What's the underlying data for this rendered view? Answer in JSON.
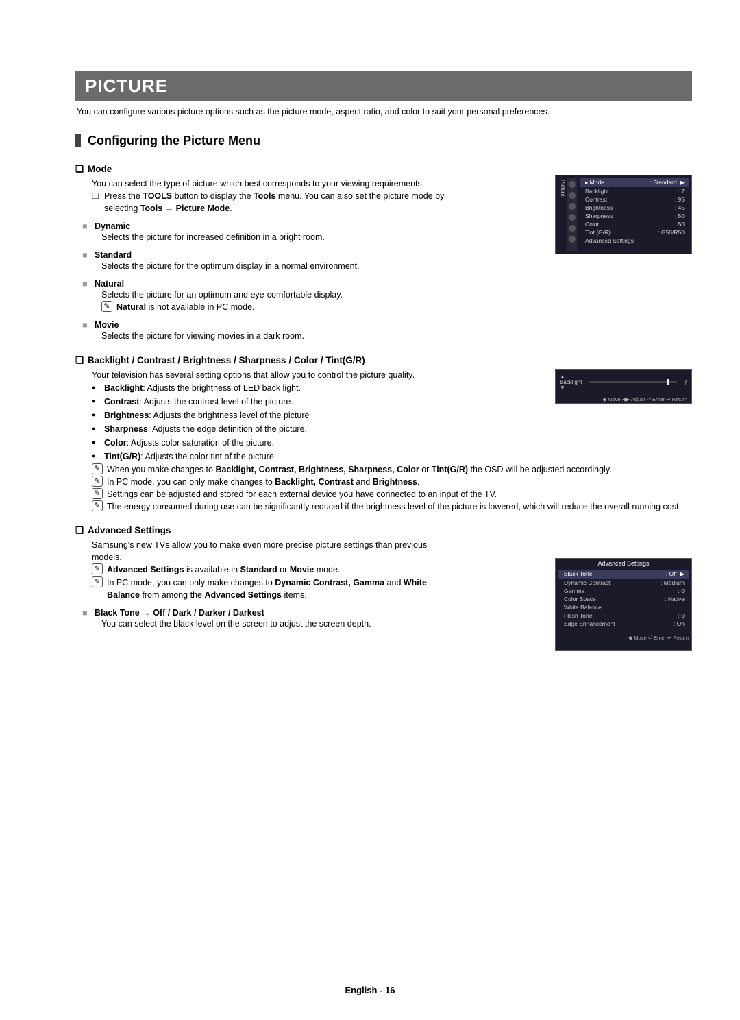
{
  "banner": {
    "title": "PICTURE",
    "subtitle": "You can configure various picture options such as the picture mode, aspect ratio, and color to suit your personal preferences."
  },
  "section_title": "Configuring the Picture Menu",
  "mode": {
    "title": "Mode",
    "intro": "You can select the type of picture which best corresponds to your viewing requirements.",
    "tools_pre": "Press the ",
    "tools_b1": "TOOLS",
    "tools_mid": " button to display the ",
    "tools_b2": "Tools",
    "tools_post": " menu. You can also set the picture mode by selecting ",
    "tools_b3": "Tools → Picture Mode",
    "tools_end": ".",
    "dynamic_t": "Dynamic",
    "dynamic_d": "Selects the picture for increased definition in a bright room.",
    "standard_t": "Standard",
    "standard_d": "Selects the picture for the optimum display in a normal environment.",
    "natural_t": "Natural",
    "natural_d": "Selects the picture for an optimum and eye-comfortable display.",
    "natural_note_b": "Natural",
    "natural_note_r": " is not available in PC mode.",
    "movie_t": "Movie",
    "movie_d": "Selects the picture for viewing movies in a dark room."
  },
  "bc": {
    "title": "Backlight / Contrast / Brightness / Sharpness / Color / Tint(G/R)",
    "intro": "Your television has several setting options that allow you to control the picture quality.",
    "d1b": "Backlight",
    "d1r": ": Adjusts the brightness of LED back light.",
    "d2b": "Contrast",
    "d2r": ": Adjusts the contrast level of the picture.",
    "d3b": "Brightness",
    "d3r": ": Adjusts the brightness level of the picture",
    "d4b": "Sharpness",
    "d4r": ": Adjusts the edge definition of the picture.",
    "d5b": "Color",
    "d5r": ": Adjusts color saturation of the picture.",
    "d6b": "Tint(G/R)",
    "d6r": ": Adjusts the color tint of the picture.",
    "n1_pre": "When you make changes to ",
    "n1_b": "Backlight, Contrast, Brightness, Sharpness, Color",
    "n1_mid": " or ",
    "n1_b2": "Tint(G/R)",
    "n1_post": " the OSD will be adjusted accordingly.",
    "n2_pre": "In PC mode, you can only make changes to ",
    "n2_b": "Backlight, Contrast",
    "n2_mid": " and ",
    "n2_b2": "Brightness",
    "n2_end": ".",
    "n3": "Settings can be adjusted and stored for each external device you have connected to an input of the TV.",
    "n4": "The energy consumed during use can be significantly reduced if the brightness level of the picture is lowered, which will reduce the overall running cost."
  },
  "adv": {
    "title": "Advanced Settings",
    "intro": "Samsung's new TVs allow you to make even more precise picture settings than previous models.",
    "n1_b": "Advanced Settings",
    "n1_mid": " is available in ",
    "n1_b2": "Standard",
    "n1_mid2": " or ",
    "n1_b3": "Movie",
    "n1_end": " mode.",
    "n2_pre": "In PC mode, you can only make changes to ",
    "n2_b": "Dynamic Contrast, Gamma",
    "n2_mid": " and ",
    "n2_b2": "White Balance",
    "n2_mid2": " from among the ",
    "n2_b3": "Advanced Settings",
    "n2_end": " items.",
    "black_t": "Black Tone → Off / Dark / Darker / Darkest",
    "black_d": "You can select the black level on the screen to adjust the screen depth."
  },
  "osd_picture": {
    "side_label": "Picture",
    "rows": [
      {
        "k": "Mode",
        "v": ": Standard",
        "hl": true,
        "arrow": "▶"
      },
      {
        "k": "Backlight",
        "v": ": 7"
      },
      {
        "k": "Contrast",
        "v": ": 95"
      },
      {
        "k": "Brightness",
        "v": ": 45"
      },
      {
        "k": "Sharpness",
        "v": ": 50"
      },
      {
        "k": "Color",
        "v": ": 50"
      },
      {
        "k": "Tint (G/R)",
        "v": ": G50/R50"
      },
      {
        "k": "Advanced Settings",
        "v": ""
      }
    ]
  },
  "osd_slider": {
    "label": "Backlight",
    "value": "7",
    "hints": "◆ Move   ◀▶ Adjust   ⏎ Enter   ↩ Return"
  },
  "osd_adv": {
    "title": "Advanced Settings",
    "rows": [
      {
        "k": "Black Tone",
        "v": ": Off",
        "hl": true,
        "arrow": "▶"
      },
      {
        "k": "Dynamic Contrast",
        "v": ": Medium"
      },
      {
        "k": "Gamma",
        "v": ": 0"
      },
      {
        "k": "Color Space",
        "v": ": Native"
      },
      {
        "k": "White Balance",
        "v": ""
      },
      {
        "k": "Flesh Tone",
        "v": ": 0"
      },
      {
        "k": "Edge Enhancement",
        "v": ": On"
      }
    ],
    "hints": "◆ Move   ⏎ Enter   ↩ Return"
  },
  "footer": "English - 16"
}
